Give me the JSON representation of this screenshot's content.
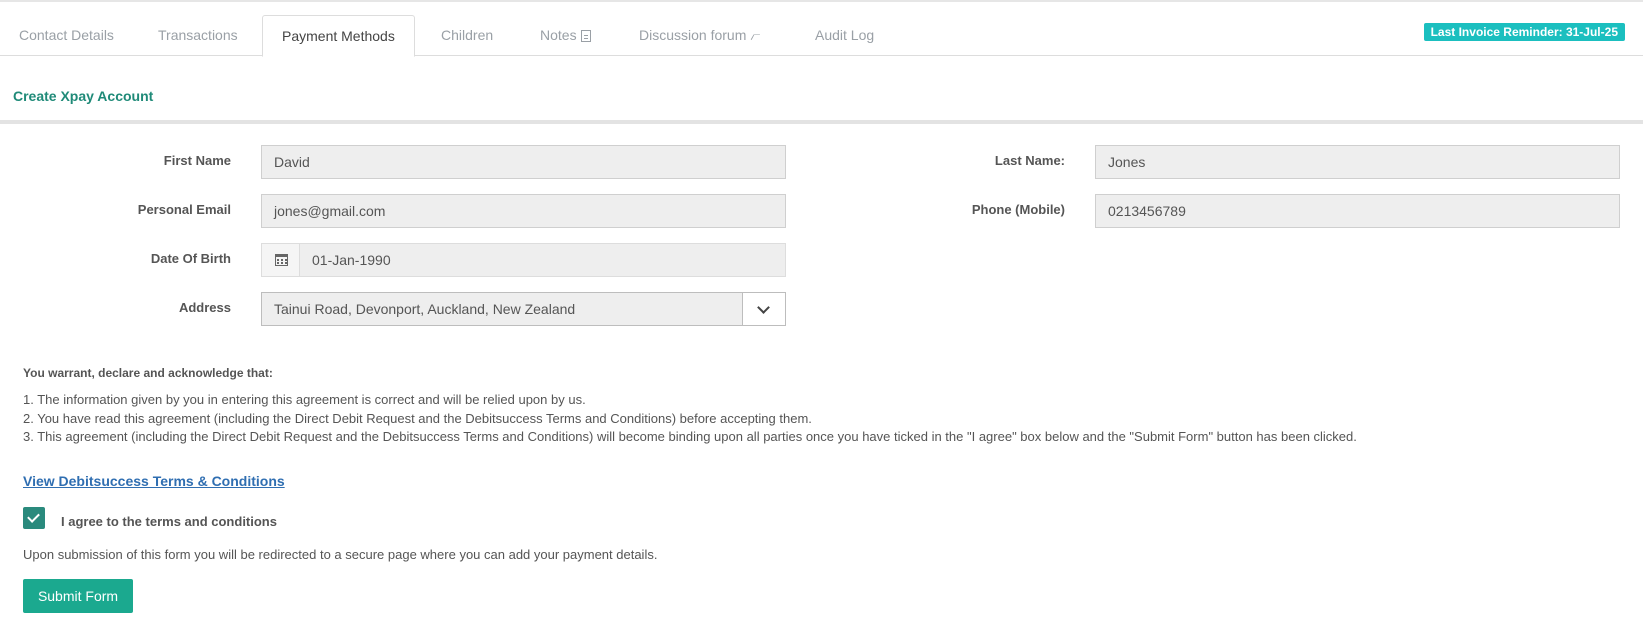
{
  "tabs": [
    {
      "label": "Contact Details",
      "active": false
    },
    {
      "label": "Transactions",
      "active": false
    },
    {
      "label": "Payment Methods",
      "active": true
    },
    {
      "label": "Children",
      "active": false
    },
    {
      "label": "Notes",
      "active": false,
      "icon": "note-icon"
    },
    {
      "label": "Discussion forum",
      "active": false,
      "icon": "signal-icon"
    },
    {
      "label": "Audit Log",
      "active": false
    }
  ],
  "badge": "Last Invoice Reminder: 31-Jul-25",
  "section_title": "Create Xpay Account",
  "form": {
    "first_name_label": "First Name",
    "first_name": "David",
    "last_name_label": "Last Name:",
    "last_name": "Jones",
    "email_label": "Personal Email",
    "email": "jones@gmail.com",
    "phone_label": "Phone (Mobile)",
    "phone": "0213456789",
    "dob_label": "Date Of Birth",
    "dob": "01-Jan-1990",
    "address_label": "Address",
    "address": "Tainui Road, Devonport, Auckland, New Zealand"
  },
  "agreement": {
    "intro": "You warrant, declare and acknowledge that:",
    "clauses": [
      "1. The information given by you in entering this agreement is correct and will be relied upon by us.",
      "2. You have read this agreement (including the Direct Debit Request and the Debitsuccess Terms and Conditions) before accepting them.",
      "3. This agreement (including the Direct Debit Request and the Debitsuccess Terms and Conditions) will become binding upon all parties once you have ticked in the \"I agree\" box below and the \"Submit Form\" button has been clicked."
    ],
    "terms_link": "View Debitsuccess Terms & Conditions",
    "agree_label": "I agree to the terms and conditions",
    "agree_checked": true,
    "redirect_note": "Upon submission of this form you will be redirected to a secure page where you can add your payment details.",
    "submit_label": "Submit Form"
  },
  "colors": {
    "accent": "#1ba98f",
    "title": "#1f8a78",
    "badge": "#1bbfbf",
    "link": "#2f6eb1"
  }
}
